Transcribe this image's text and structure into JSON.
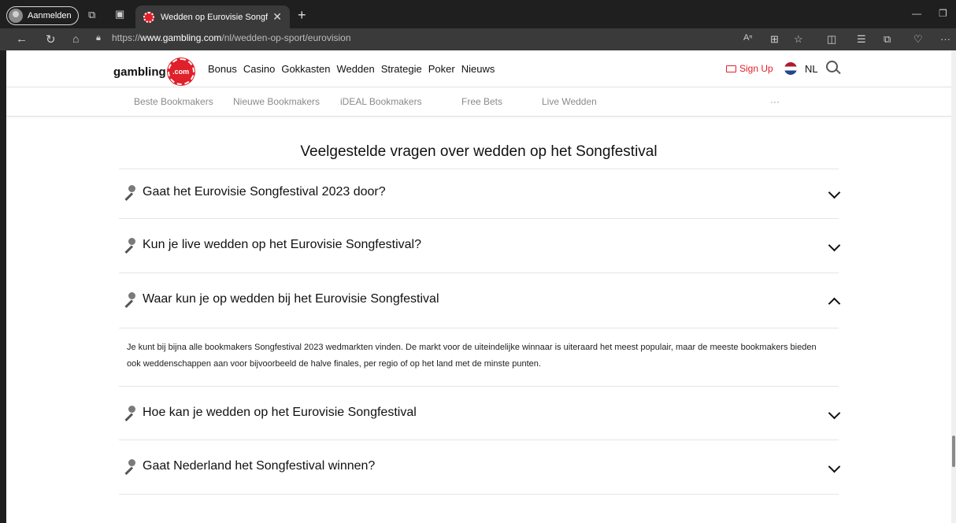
{
  "browser": {
    "profile_label": "Aanmelden",
    "tab_title": "Wedden op Eurovisie Songfestival",
    "url_prefix": "https://",
    "url_domain": "www.gambling.com",
    "url_path": "/nl/wedden-op-sport/eurovision"
  },
  "header": {
    "logo_text": "gambling",
    "logo_chip": ".com",
    "nav": [
      "Bonus",
      "Casino",
      "Gokkasten",
      "Wedden",
      "Strategie",
      "Poker",
      "Nieuws"
    ],
    "signup_label": "Sign Up",
    "lang_label": "NL"
  },
  "subnav": [
    "Beste Bookmakers",
    "Nieuwe Bookmakers",
    "iDEAL Bookmakers",
    "Free Bets",
    "Live Wedden",
    "···"
  ],
  "faq": {
    "title": "Veelgestelde vragen over wedden op het Songfestival",
    "items": [
      {
        "question": "Gaat het Eurovisie Songfestival 2023 door?",
        "expanded": false
      },
      {
        "question": "Kun je live wedden op het Eurovisie Songfestival?",
        "expanded": false
      },
      {
        "question": "Waar kun je op wedden bij het Eurovisie Songfestival",
        "expanded": true
      },
      {
        "question": "Hoe kan je wedden op het Eurovisie Songfestival",
        "expanded": false
      },
      {
        "question": "Gaat Nederland het Songfestival winnen?",
        "expanded": false
      }
    ],
    "answer": "Je kunt bij bijna alle bookmakers Songfestival 2023 wedmarkten vinden. De markt voor de uiteindelijke winnaar is uiteraard het meest populair, maar de meeste bookmakers bieden ook weddenschappen aan voor bijvoorbeeld de halve finales, per regio of op het land met de minste punten."
  },
  "colors": {
    "brand_red": "#e0202a",
    "text": "#111111",
    "muted": "#8a8a8a"
  }
}
